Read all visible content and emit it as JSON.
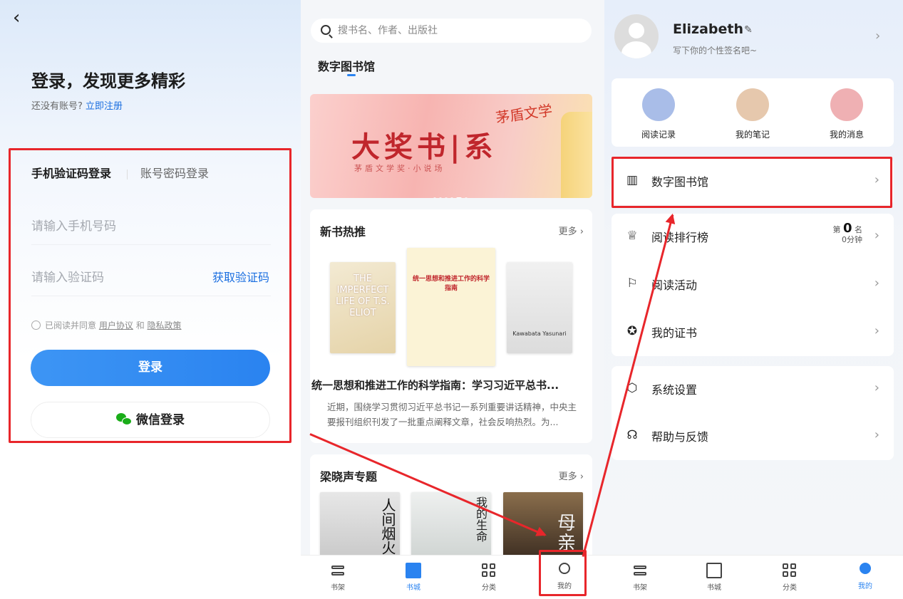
{
  "login": {
    "title": "登录，发现更多精彩",
    "no_account": "还没有账号?",
    "register": "立即注册",
    "tab_sms": "手机验证码登录",
    "tab_password": "账号密码登录",
    "phone_placeholder": "请输入手机号码",
    "code_placeholder": "请输入验证码",
    "get_code": "获取验证码",
    "agree_prefix": "已阅读并同意",
    "user_agreement": "用户协议",
    "and": "和",
    "privacy": "隐私政策",
    "login_button": "登录",
    "wechat_button": "微信登录"
  },
  "store": {
    "search_placeholder": "搜书名、作者、出版社",
    "section": "数字图书馆",
    "banner": {
      "main": "大奖书|系",
      "sub": "茅盾文学奖·小说场",
      "tag": "茅盾文学"
    },
    "new_books": {
      "title": "新书热推",
      "more": "更多 ›",
      "covers": [
        {
          "text": "THE IMPERFECT LIFE OF T.S. ELIOT"
        },
        {
          "text": "统一思想和推进工作的科学指南"
        },
        {
          "text": "Kawabata Yasunari"
        }
      ],
      "headline": "统一思想和推进工作的科学指南：学习习近平总书...",
      "desc": "近期，围绕学习贯彻习近平总书记一系列重要讲话精神，中央主要报刊组织刊发了一批重点阐释文章，社会反响热烈。为..."
    },
    "special": {
      "title": "梁晓声专题",
      "more": "更多 ›",
      "covers": [
        {
          "text": "人间烟火"
        },
        {
          "text": "我的生命"
        },
        {
          "text": "母亲"
        }
      ]
    }
  },
  "tabbar": [
    {
      "label": "书架",
      "icon": "shelf-icon"
    },
    {
      "label": "书城",
      "icon": "book-icon"
    },
    {
      "label": "分类",
      "icon": "category-icon"
    },
    {
      "label": "我的",
      "icon": "profile-icon"
    }
  ],
  "profile": {
    "name": "Elizabeth",
    "signature": "写下你的个性签名吧~",
    "quick": [
      {
        "label": "阅读记录",
        "color": "#a9bde8",
        "icon": "clock-icon"
      },
      {
        "label": "我的笔记",
        "color": "#e6c8ad",
        "icon": "feather-icon"
      },
      {
        "label": "我的消息",
        "color": "#efb0b3",
        "icon": "message-icon"
      }
    ],
    "menu1": {
      "label": "数字图书馆",
      "icon": "library-icon"
    },
    "menu2": [
      {
        "label": "阅读排行榜",
        "icon": "trophy-icon"
      },
      {
        "label": "阅读活动",
        "icon": "flag-icon"
      },
      {
        "label": "我的证书",
        "icon": "certificate-icon"
      }
    ],
    "rank": {
      "prefix": "第",
      "value": "0",
      "suffix": "名",
      "minutes": "0分钟"
    },
    "menu3": [
      {
        "label": "系统设置",
        "icon": "settings-icon"
      },
      {
        "label": "帮助与反馈",
        "icon": "headset-icon"
      }
    ]
  },
  "colors": {
    "accent": "#2a83f0",
    "highlight": "#e8262b"
  }
}
